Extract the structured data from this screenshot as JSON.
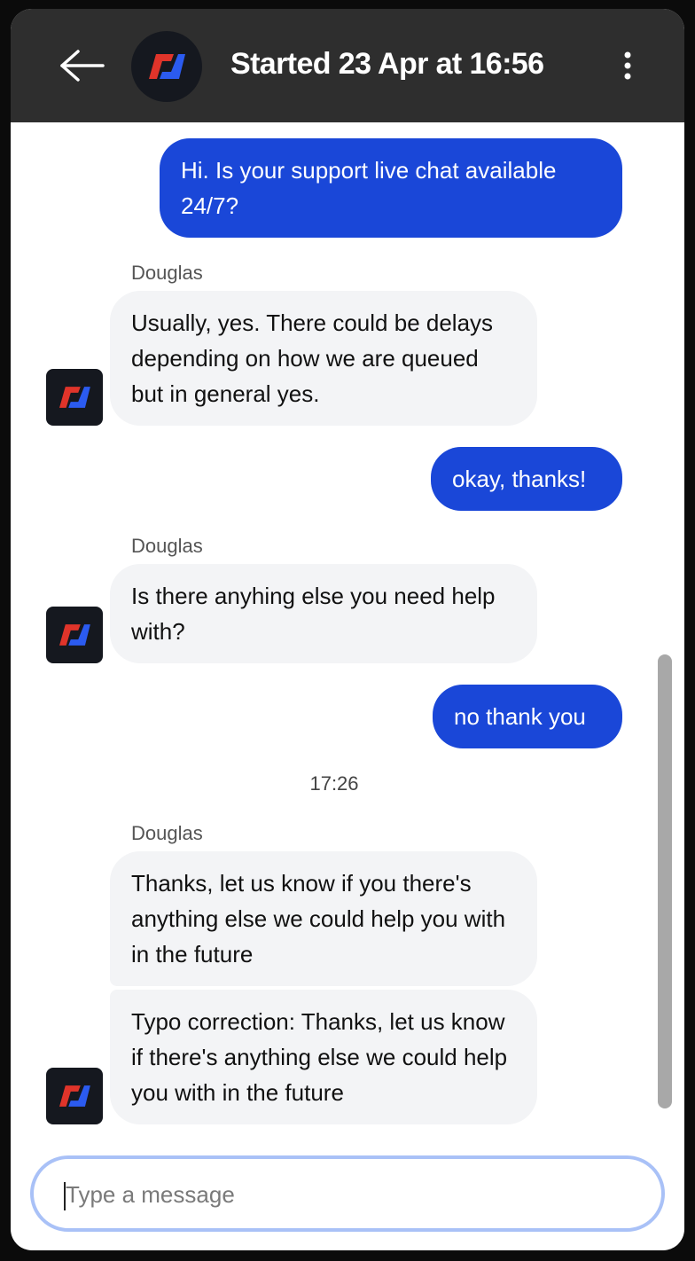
{
  "header": {
    "title": "Started 23 Apr at 16:56",
    "back_icon": "arrow-left-icon",
    "menu_icon": "vertical-dots-icon",
    "logo_icon": "brand-logo-icon"
  },
  "conversation": {
    "out_1": "Hi. Is your support live chat available 24/7?",
    "sender_1": "Douglas",
    "in_1": "Usually, yes. There could be delays depending on how we are queued but in general yes.",
    "out_2": "okay, thanks!",
    "sender_2": "Douglas",
    "in_2": "Is there anyhing else you need help with?",
    "out_3": "no thank you",
    "time_separator": "17:26",
    "sender_3": "Douglas",
    "in_3": "Thanks, let us know if you there's anything else we could help you with in the future",
    "in_4": "Typo correction: Thanks, let us know if there's anything else we could help you with in the future"
  },
  "composer": {
    "placeholder": "Type a message",
    "value": ""
  },
  "colors": {
    "outgoing_bubble": "#1a47d8",
    "incoming_bubble": "#f3f4f6",
    "header_bg": "#2e2e2e",
    "logo_red": "#e0342a",
    "logo_blue": "#2b5bf0"
  }
}
